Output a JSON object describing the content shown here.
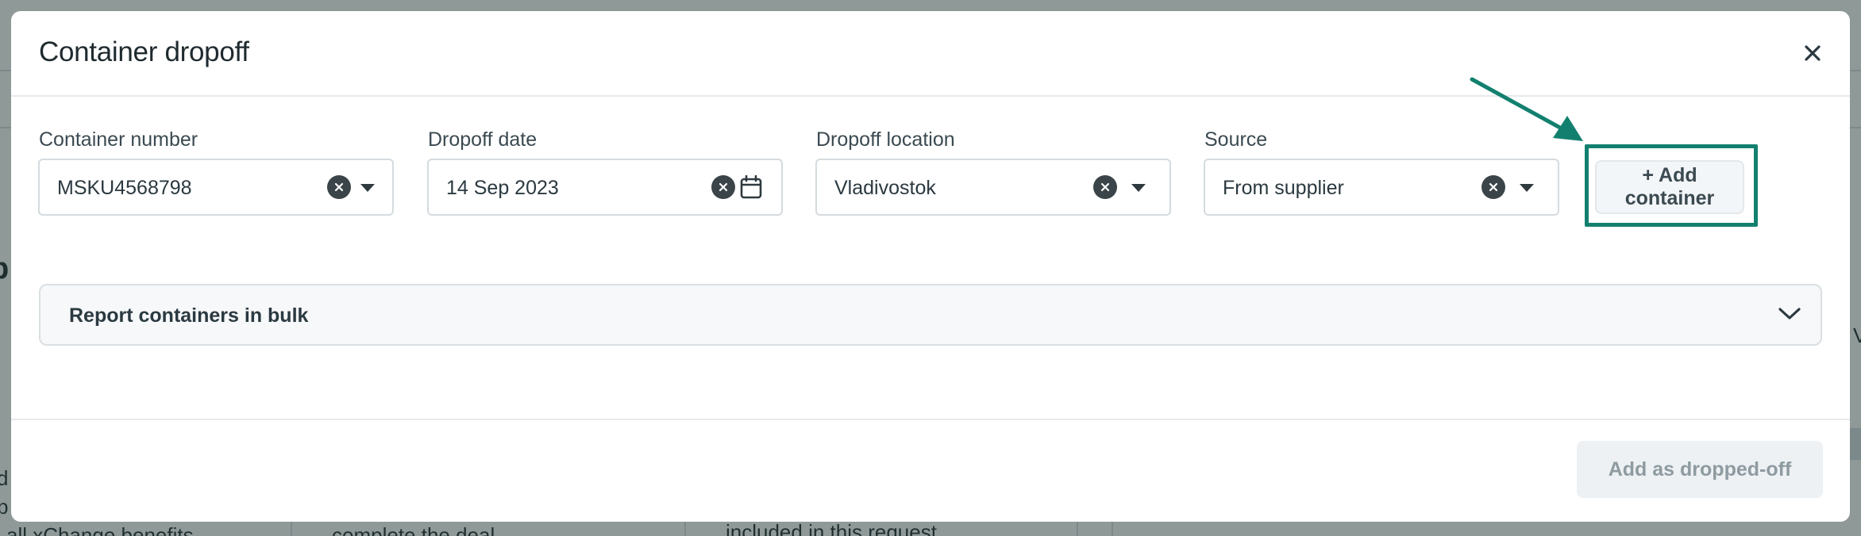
{
  "background": {
    "heading_fragment": "p",
    "text_fragments": [
      "d",
      "p",
      "all xChange benefits",
      "complete the deal",
      "included in this request",
      "V"
    ]
  },
  "modal": {
    "title": "Container dropoff",
    "close_icon": "close-icon"
  },
  "form": {
    "container_number": {
      "label": "Container number",
      "value": "MSKU4568798"
    },
    "dropoff_date": {
      "label": "Dropoff date",
      "value": "14 Sep 2023"
    },
    "dropoff_location": {
      "label": "Dropoff location",
      "value": "Vladivostok"
    },
    "source": {
      "label": "Source",
      "value": "From supplier"
    },
    "add_container_label": "+ Add container"
  },
  "bulk": {
    "title": "Report containers in bulk"
  },
  "footer": {
    "submit_label": "Add as dropped-off"
  },
  "colors": {
    "accent": "#13806f",
    "overlay": "#8e9c9b",
    "disabled_text": "#8e9ba1"
  }
}
